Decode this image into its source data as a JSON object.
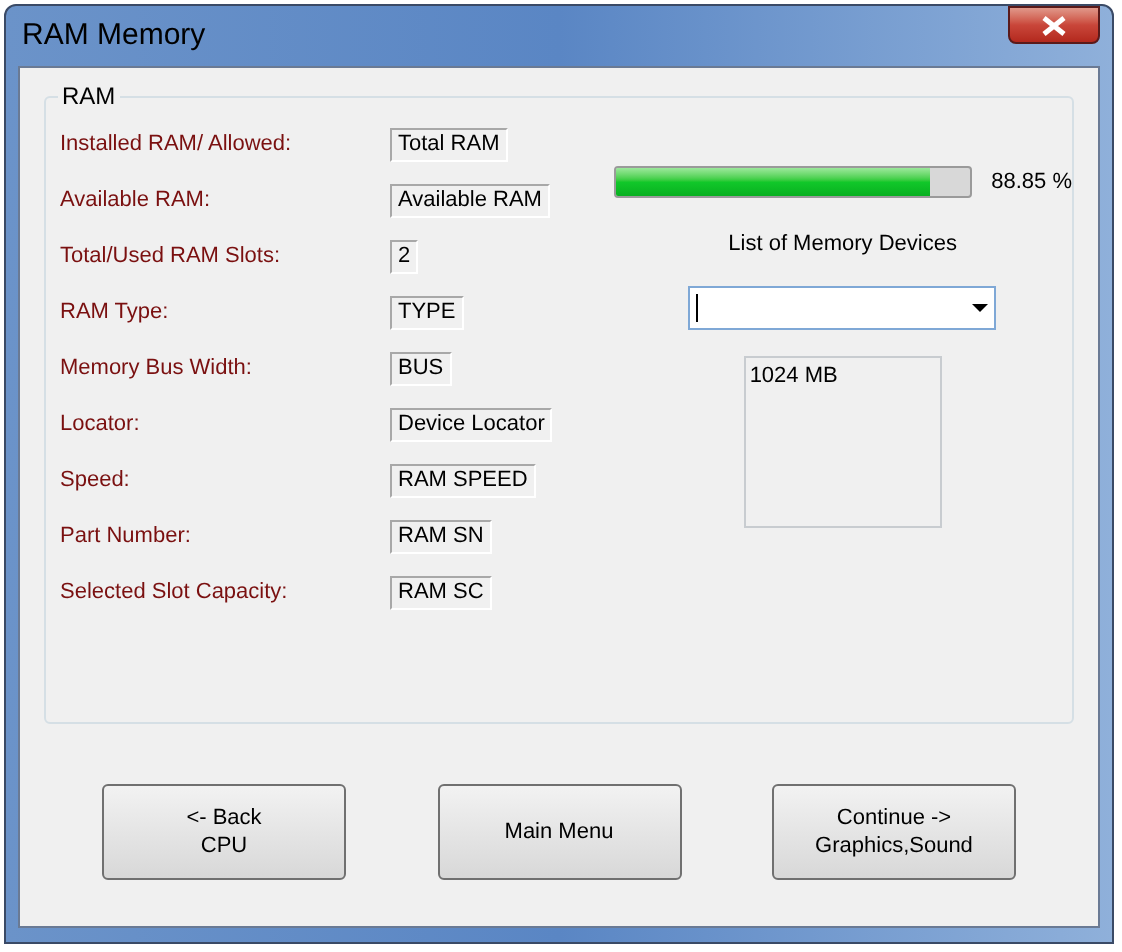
{
  "window": {
    "title": "RAM Memory"
  },
  "group": {
    "label": "RAM"
  },
  "fields": [
    {
      "label": "Installed RAM/ Allowed:",
      "value": "Total RAM"
    },
    {
      "label": "Available RAM:",
      "value": "Available RAM"
    },
    {
      "label": "Total/Used RAM Slots:",
      "value": "2"
    },
    {
      "label": "RAM Type:",
      "value": "TYPE"
    },
    {
      "label": "Memory Bus Width:",
      "value": "BUS"
    },
    {
      "label": "Locator:",
      "value": "Device Locator"
    },
    {
      "label": "Speed:",
      "value": "RAM SPEED"
    },
    {
      "label": "Part Number:",
      "value": "RAM SN"
    },
    {
      "label": "Selected Slot Capacity:",
      "value": "RAM SC"
    }
  ],
  "usage": {
    "level": 0.8885,
    "reading": "88.85 %"
  },
  "devices": {
    "label": "List of Memory Devices",
    "items": [
      "1024 MB"
    ]
  },
  "buttons": [
    "<- Back\nCPU",
    "Main Menu",
    "Continue ->\nGraphics,Sound"
  ]
}
